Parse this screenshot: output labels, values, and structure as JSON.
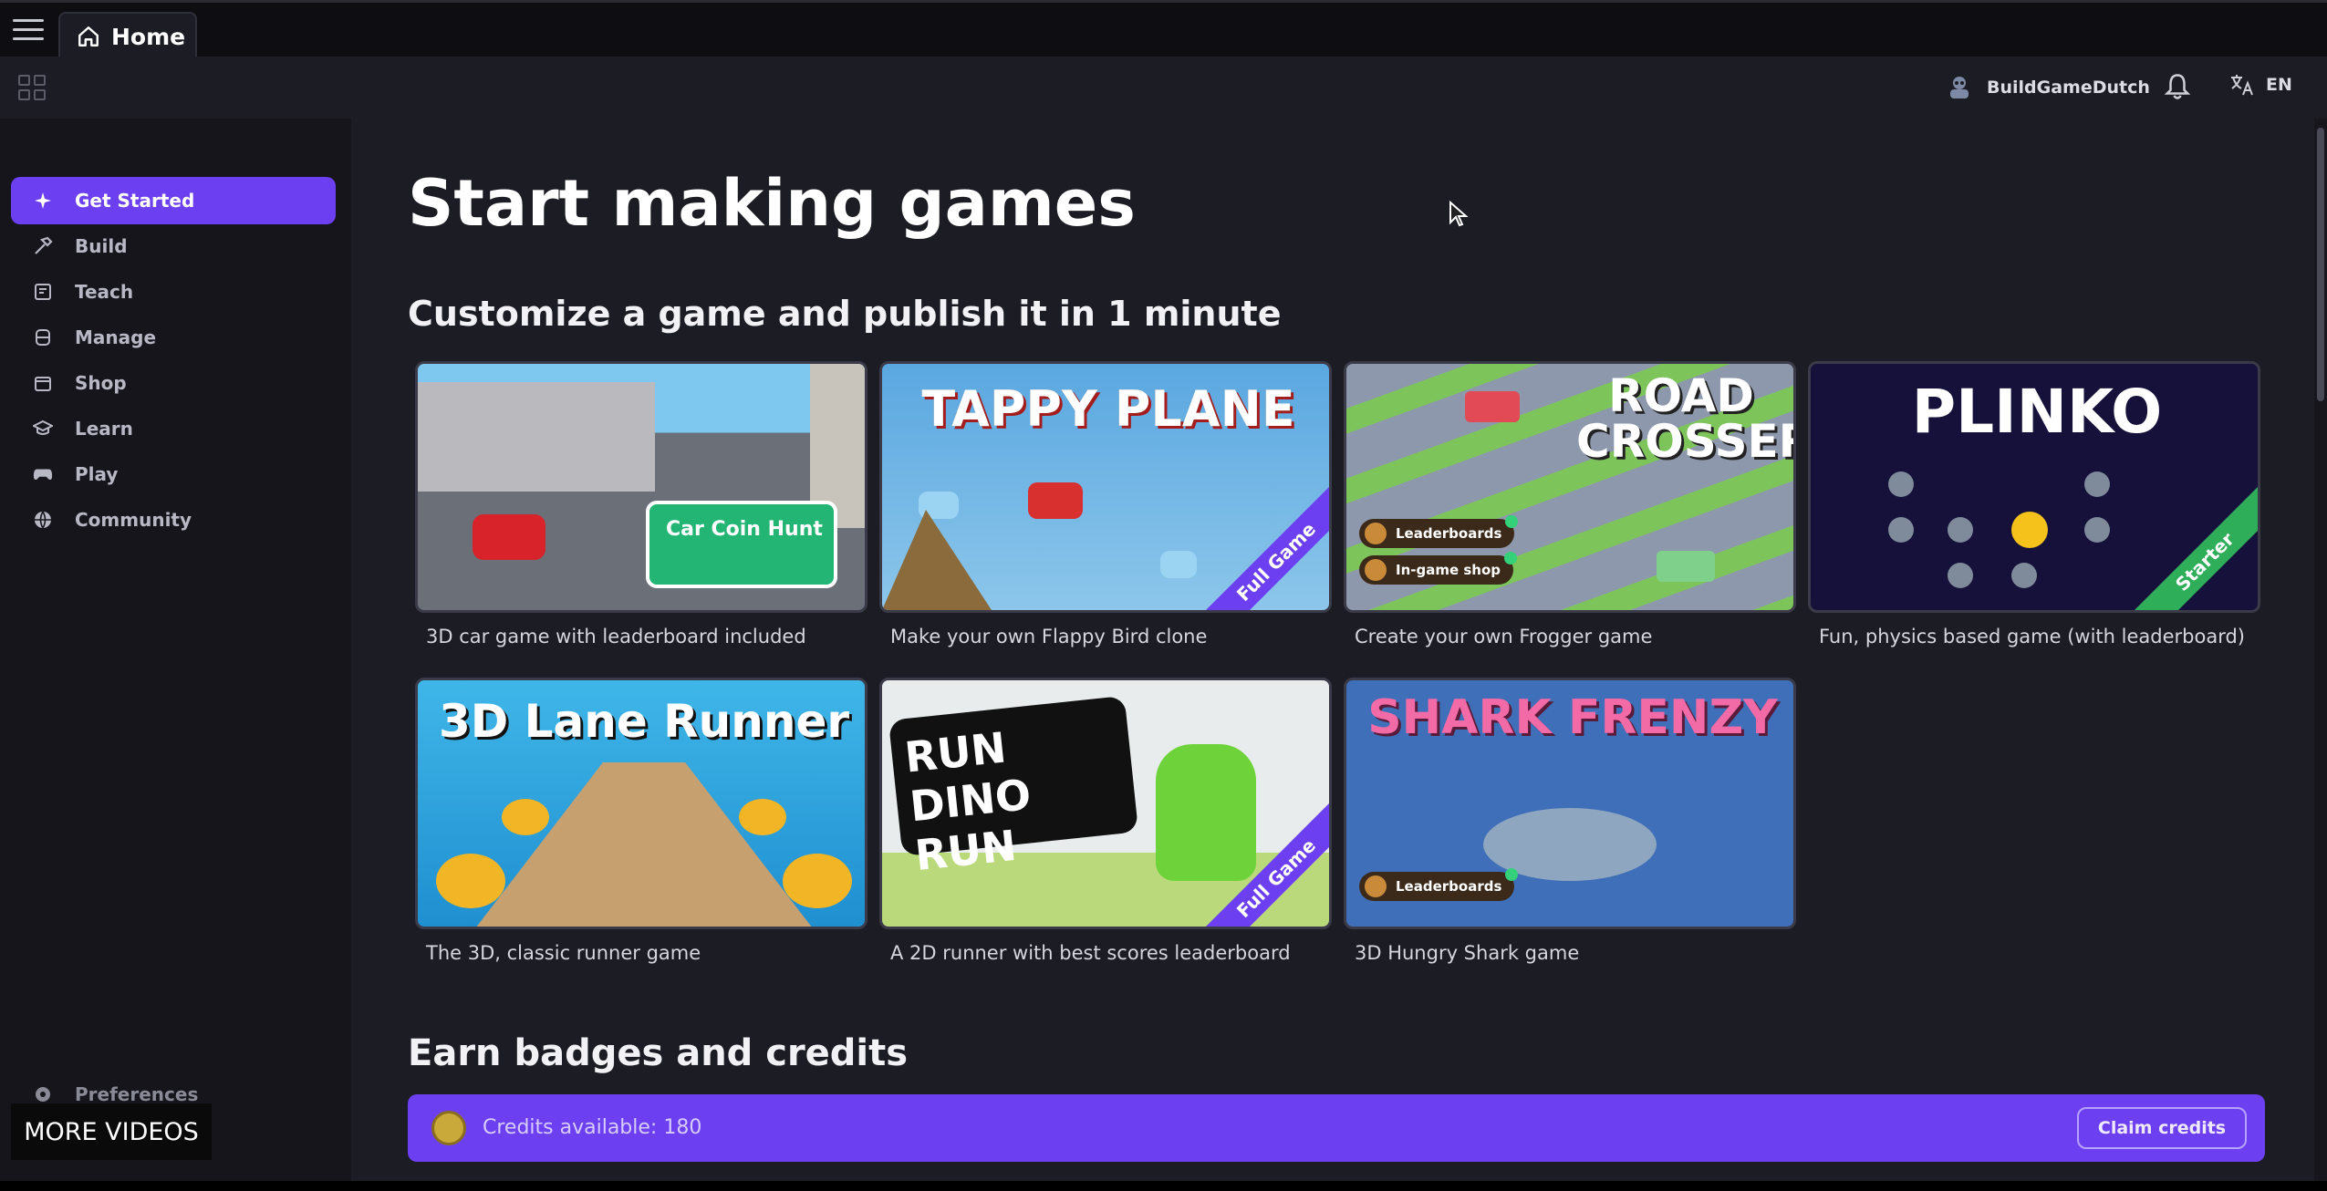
{
  "tabs": [
    {
      "label": "Home"
    }
  ],
  "user": {
    "name": "BuildGameDutch"
  },
  "language": {
    "code": "EN"
  },
  "sidebar": {
    "items": [
      {
        "label": "Get Started",
        "icon": "sparkle-icon",
        "active": true
      },
      {
        "label": "Build",
        "icon": "hammer-icon"
      },
      {
        "label": "Teach",
        "icon": "teach-icon"
      },
      {
        "label": "Manage",
        "icon": "database-icon"
      },
      {
        "label": "Shop",
        "icon": "shop-icon"
      },
      {
        "label": "Learn",
        "icon": "graduation-cap-icon"
      },
      {
        "label": "Play",
        "icon": "gamepad-icon"
      },
      {
        "label": "Community",
        "icon": "globe-icon"
      }
    ],
    "preferences_label": "Preferences"
  },
  "overlay": {
    "more_videos": "MORE VIDEOS"
  },
  "main": {
    "title": "Start making games",
    "section1_title": "Customize a game and publish it in 1 minute",
    "section2_title": "Earn badges and credits",
    "games": [
      {
        "caption": "3D car game with leaderboard included",
        "thumb_title": "Car Coin Hunt"
      },
      {
        "caption": "Make your own Flappy Bird clone",
        "thumb_title": "TAPPY PLANE",
        "ribbon": "Full Game"
      },
      {
        "caption": "Create your own Frogger game",
        "thumb_title": "ROAD CROSSER",
        "badges": [
          "Leaderboards",
          "In-game shop"
        ]
      },
      {
        "caption": "Fun, physics based game (with leaderboard)",
        "thumb_title": "PLINKO",
        "ribbon": "Starter"
      },
      {
        "caption": "The 3D, classic runner game",
        "thumb_title": "3D Lane Runner"
      },
      {
        "caption": "A 2D runner with best scores leaderboard",
        "thumb_title": "RUN DINO RUN",
        "ribbon": "Full Game"
      },
      {
        "caption": "3D Hungry Shark game",
        "thumb_title": "SHARK FRENZY",
        "badges": [
          "Leaderboards"
        ]
      }
    ]
  },
  "credits": {
    "text": "Credits available: 180",
    "button": "Claim credits"
  },
  "colors": {
    "accent": "#6c3ff0",
    "sidebar_bg": "#15151b",
    "main_bg": "#1c1c24"
  }
}
